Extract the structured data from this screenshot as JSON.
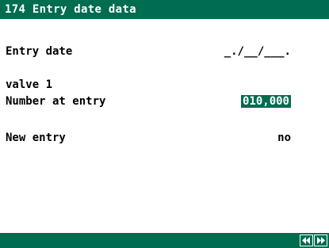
{
  "title": "174 Entry date data",
  "fields": {
    "entry_date": {
      "label": "Entry date",
      "value": "_./__/___."
    },
    "valve": {
      "label": "valve 1"
    },
    "number_at_entry": {
      "label": "Number at entry",
      "value": "010,000"
    },
    "new_entry": {
      "label": "New entry",
      "value": "no"
    }
  },
  "colors": {
    "accent": "#006c50",
    "background": "#ffffff",
    "text": "#000000"
  },
  "icons": {
    "prev": "double-left-arrow-icon",
    "next": "double-right-arrow-icon"
  }
}
